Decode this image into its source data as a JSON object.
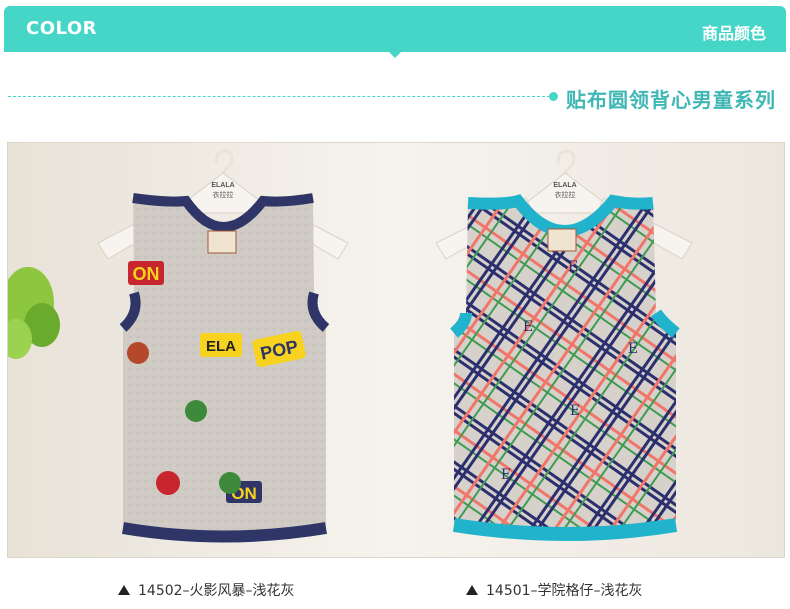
{
  "header": {
    "title": "COLOR",
    "title_cn": "商品颜色",
    "accent_color": "#45d6c7"
  },
  "subtitle": "贴布圆领背心男童系列",
  "products": [
    {
      "hanger_brand": "ELALA",
      "hanger_brand_cn": "衣拉拉",
      "caption": "14502–火影风暴–浅花灰",
      "trim_color": "#2f3566",
      "body_color": "#cfcac3",
      "print_words": [
        "ON",
        "ELA",
        "POP",
        "ON"
      ]
    },
    {
      "hanger_brand": "ELALA",
      "hanger_brand_cn": "衣拉拉",
      "caption": "14501–学院格仔–浅花灰",
      "trim_color": "#22b3cc",
      "body_color": "#d6d2cb",
      "print_letter": "E"
    }
  ]
}
